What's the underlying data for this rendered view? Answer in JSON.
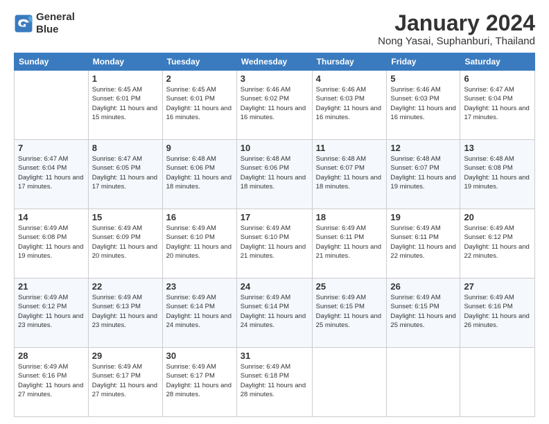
{
  "logo": {
    "line1": "General",
    "line2": "Blue"
  },
  "title": "January 2024",
  "subtitle": "Nong Yasai, Suphanburi, Thailand",
  "weekdays": [
    "Sunday",
    "Monday",
    "Tuesday",
    "Wednesday",
    "Thursday",
    "Friday",
    "Saturday"
  ],
  "weeks": [
    [
      {
        "day": "",
        "sunrise": "",
        "sunset": "",
        "daylight": ""
      },
      {
        "day": "1",
        "sunrise": "Sunrise: 6:45 AM",
        "sunset": "Sunset: 6:01 PM",
        "daylight": "Daylight: 11 hours and 15 minutes."
      },
      {
        "day": "2",
        "sunrise": "Sunrise: 6:45 AM",
        "sunset": "Sunset: 6:01 PM",
        "daylight": "Daylight: 11 hours and 16 minutes."
      },
      {
        "day": "3",
        "sunrise": "Sunrise: 6:46 AM",
        "sunset": "Sunset: 6:02 PM",
        "daylight": "Daylight: 11 hours and 16 minutes."
      },
      {
        "day": "4",
        "sunrise": "Sunrise: 6:46 AM",
        "sunset": "Sunset: 6:03 PM",
        "daylight": "Daylight: 11 hours and 16 minutes."
      },
      {
        "day": "5",
        "sunrise": "Sunrise: 6:46 AM",
        "sunset": "Sunset: 6:03 PM",
        "daylight": "Daylight: 11 hours and 16 minutes."
      },
      {
        "day": "6",
        "sunrise": "Sunrise: 6:47 AM",
        "sunset": "Sunset: 6:04 PM",
        "daylight": "Daylight: 11 hours and 17 minutes."
      }
    ],
    [
      {
        "day": "7",
        "sunrise": "Sunrise: 6:47 AM",
        "sunset": "Sunset: 6:04 PM",
        "daylight": "Daylight: 11 hours and 17 minutes."
      },
      {
        "day": "8",
        "sunrise": "Sunrise: 6:47 AM",
        "sunset": "Sunset: 6:05 PM",
        "daylight": "Daylight: 11 hours and 17 minutes."
      },
      {
        "day": "9",
        "sunrise": "Sunrise: 6:48 AM",
        "sunset": "Sunset: 6:06 PM",
        "daylight": "Daylight: 11 hours and 18 minutes."
      },
      {
        "day": "10",
        "sunrise": "Sunrise: 6:48 AM",
        "sunset": "Sunset: 6:06 PM",
        "daylight": "Daylight: 11 hours and 18 minutes."
      },
      {
        "day": "11",
        "sunrise": "Sunrise: 6:48 AM",
        "sunset": "Sunset: 6:07 PM",
        "daylight": "Daylight: 11 hours and 18 minutes."
      },
      {
        "day": "12",
        "sunrise": "Sunrise: 6:48 AM",
        "sunset": "Sunset: 6:07 PM",
        "daylight": "Daylight: 11 hours and 19 minutes."
      },
      {
        "day": "13",
        "sunrise": "Sunrise: 6:48 AM",
        "sunset": "Sunset: 6:08 PM",
        "daylight": "Daylight: 11 hours and 19 minutes."
      }
    ],
    [
      {
        "day": "14",
        "sunrise": "Sunrise: 6:49 AM",
        "sunset": "Sunset: 6:08 PM",
        "daylight": "Daylight: 11 hours and 19 minutes."
      },
      {
        "day": "15",
        "sunrise": "Sunrise: 6:49 AM",
        "sunset": "Sunset: 6:09 PM",
        "daylight": "Daylight: 11 hours and 20 minutes."
      },
      {
        "day": "16",
        "sunrise": "Sunrise: 6:49 AM",
        "sunset": "Sunset: 6:10 PM",
        "daylight": "Daylight: 11 hours and 20 minutes."
      },
      {
        "day": "17",
        "sunrise": "Sunrise: 6:49 AM",
        "sunset": "Sunset: 6:10 PM",
        "daylight": "Daylight: 11 hours and 21 minutes."
      },
      {
        "day": "18",
        "sunrise": "Sunrise: 6:49 AM",
        "sunset": "Sunset: 6:11 PM",
        "daylight": "Daylight: 11 hours and 21 minutes."
      },
      {
        "day": "19",
        "sunrise": "Sunrise: 6:49 AM",
        "sunset": "Sunset: 6:11 PM",
        "daylight": "Daylight: 11 hours and 22 minutes."
      },
      {
        "day": "20",
        "sunrise": "Sunrise: 6:49 AM",
        "sunset": "Sunset: 6:12 PM",
        "daylight": "Daylight: 11 hours and 22 minutes."
      }
    ],
    [
      {
        "day": "21",
        "sunrise": "Sunrise: 6:49 AM",
        "sunset": "Sunset: 6:12 PM",
        "daylight": "Daylight: 11 hours and 23 minutes."
      },
      {
        "day": "22",
        "sunrise": "Sunrise: 6:49 AM",
        "sunset": "Sunset: 6:13 PM",
        "daylight": "Daylight: 11 hours and 23 minutes."
      },
      {
        "day": "23",
        "sunrise": "Sunrise: 6:49 AM",
        "sunset": "Sunset: 6:14 PM",
        "daylight": "Daylight: 11 hours and 24 minutes."
      },
      {
        "day": "24",
        "sunrise": "Sunrise: 6:49 AM",
        "sunset": "Sunset: 6:14 PM",
        "daylight": "Daylight: 11 hours and 24 minutes."
      },
      {
        "day": "25",
        "sunrise": "Sunrise: 6:49 AM",
        "sunset": "Sunset: 6:15 PM",
        "daylight": "Daylight: 11 hours and 25 minutes."
      },
      {
        "day": "26",
        "sunrise": "Sunrise: 6:49 AM",
        "sunset": "Sunset: 6:15 PM",
        "daylight": "Daylight: 11 hours and 25 minutes."
      },
      {
        "day": "27",
        "sunrise": "Sunrise: 6:49 AM",
        "sunset": "Sunset: 6:16 PM",
        "daylight": "Daylight: 11 hours and 26 minutes."
      }
    ],
    [
      {
        "day": "28",
        "sunrise": "Sunrise: 6:49 AM",
        "sunset": "Sunset: 6:16 PM",
        "daylight": "Daylight: 11 hours and 27 minutes."
      },
      {
        "day": "29",
        "sunrise": "Sunrise: 6:49 AM",
        "sunset": "Sunset: 6:17 PM",
        "daylight": "Daylight: 11 hours and 27 minutes."
      },
      {
        "day": "30",
        "sunrise": "Sunrise: 6:49 AM",
        "sunset": "Sunset: 6:17 PM",
        "daylight": "Daylight: 11 hours and 28 minutes."
      },
      {
        "day": "31",
        "sunrise": "Sunrise: 6:49 AM",
        "sunset": "Sunset: 6:18 PM",
        "daylight": "Daylight: 11 hours and 28 minutes."
      },
      {
        "day": "",
        "sunrise": "",
        "sunset": "",
        "daylight": ""
      },
      {
        "day": "",
        "sunrise": "",
        "sunset": "",
        "daylight": ""
      },
      {
        "day": "",
        "sunrise": "",
        "sunset": "",
        "daylight": ""
      }
    ]
  ]
}
